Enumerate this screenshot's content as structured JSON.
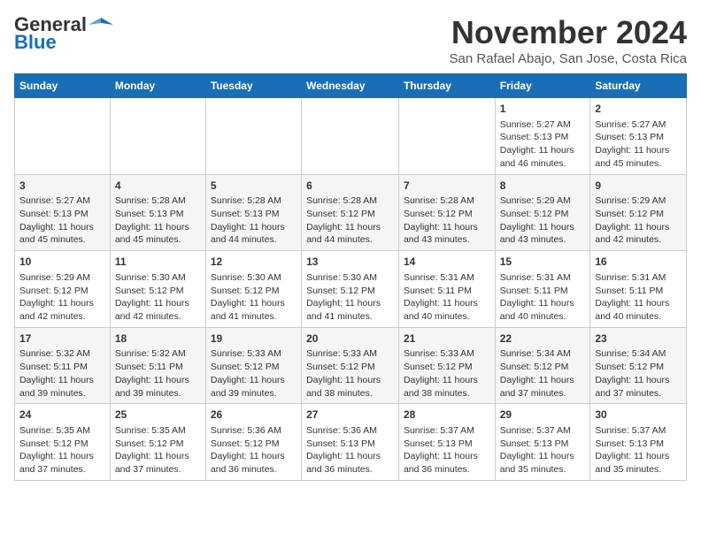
{
  "logo": {
    "line1": "General",
    "line2": "Blue"
  },
  "title": "November 2024",
  "subtitle": "San Rafael Abajo, San Jose, Costa Rica",
  "days_of_week": [
    "Sunday",
    "Monday",
    "Tuesday",
    "Wednesday",
    "Thursday",
    "Friday",
    "Saturday"
  ],
  "weeks": [
    [
      {
        "day": "",
        "info": ""
      },
      {
        "day": "",
        "info": ""
      },
      {
        "day": "",
        "info": ""
      },
      {
        "day": "",
        "info": ""
      },
      {
        "day": "",
        "info": ""
      },
      {
        "day": "1",
        "info": "Sunrise: 5:27 AM\nSunset: 5:13 PM\nDaylight: 11 hours and 46 minutes."
      },
      {
        "day": "2",
        "info": "Sunrise: 5:27 AM\nSunset: 5:13 PM\nDaylight: 11 hours and 45 minutes."
      }
    ],
    [
      {
        "day": "3",
        "info": "Sunrise: 5:27 AM\nSunset: 5:13 PM\nDaylight: 11 hours and 45 minutes."
      },
      {
        "day": "4",
        "info": "Sunrise: 5:28 AM\nSunset: 5:13 PM\nDaylight: 11 hours and 45 minutes."
      },
      {
        "day": "5",
        "info": "Sunrise: 5:28 AM\nSunset: 5:13 PM\nDaylight: 11 hours and 44 minutes."
      },
      {
        "day": "6",
        "info": "Sunrise: 5:28 AM\nSunset: 5:12 PM\nDaylight: 11 hours and 44 minutes."
      },
      {
        "day": "7",
        "info": "Sunrise: 5:28 AM\nSunset: 5:12 PM\nDaylight: 11 hours and 43 minutes."
      },
      {
        "day": "8",
        "info": "Sunrise: 5:29 AM\nSunset: 5:12 PM\nDaylight: 11 hours and 43 minutes."
      },
      {
        "day": "9",
        "info": "Sunrise: 5:29 AM\nSunset: 5:12 PM\nDaylight: 11 hours and 42 minutes."
      }
    ],
    [
      {
        "day": "10",
        "info": "Sunrise: 5:29 AM\nSunset: 5:12 PM\nDaylight: 11 hours and 42 minutes."
      },
      {
        "day": "11",
        "info": "Sunrise: 5:30 AM\nSunset: 5:12 PM\nDaylight: 11 hours and 42 minutes."
      },
      {
        "day": "12",
        "info": "Sunrise: 5:30 AM\nSunset: 5:12 PM\nDaylight: 11 hours and 41 minutes."
      },
      {
        "day": "13",
        "info": "Sunrise: 5:30 AM\nSunset: 5:12 PM\nDaylight: 11 hours and 41 minutes."
      },
      {
        "day": "14",
        "info": "Sunrise: 5:31 AM\nSunset: 5:11 PM\nDaylight: 11 hours and 40 minutes."
      },
      {
        "day": "15",
        "info": "Sunrise: 5:31 AM\nSunset: 5:11 PM\nDaylight: 11 hours and 40 minutes."
      },
      {
        "day": "16",
        "info": "Sunrise: 5:31 AM\nSunset: 5:11 PM\nDaylight: 11 hours and 40 minutes."
      }
    ],
    [
      {
        "day": "17",
        "info": "Sunrise: 5:32 AM\nSunset: 5:11 PM\nDaylight: 11 hours and 39 minutes."
      },
      {
        "day": "18",
        "info": "Sunrise: 5:32 AM\nSunset: 5:11 PM\nDaylight: 11 hours and 39 minutes."
      },
      {
        "day": "19",
        "info": "Sunrise: 5:33 AM\nSunset: 5:12 PM\nDaylight: 11 hours and 39 minutes."
      },
      {
        "day": "20",
        "info": "Sunrise: 5:33 AM\nSunset: 5:12 PM\nDaylight: 11 hours and 38 minutes."
      },
      {
        "day": "21",
        "info": "Sunrise: 5:33 AM\nSunset: 5:12 PM\nDaylight: 11 hours and 38 minutes."
      },
      {
        "day": "22",
        "info": "Sunrise: 5:34 AM\nSunset: 5:12 PM\nDaylight: 11 hours and 37 minutes."
      },
      {
        "day": "23",
        "info": "Sunrise: 5:34 AM\nSunset: 5:12 PM\nDaylight: 11 hours and 37 minutes."
      }
    ],
    [
      {
        "day": "24",
        "info": "Sunrise: 5:35 AM\nSunset: 5:12 PM\nDaylight: 11 hours and 37 minutes."
      },
      {
        "day": "25",
        "info": "Sunrise: 5:35 AM\nSunset: 5:12 PM\nDaylight: 11 hours and 37 minutes."
      },
      {
        "day": "26",
        "info": "Sunrise: 5:36 AM\nSunset: 5:12 PM\nDaylight: 11 hours and 36 minutes."
      },
      {
        "day": "27",
        "info": "Sunrise: 5:36 AM\nSunset: 5:13 PM\nDaylight: 11 hours and 36 minutes."
      },
      {
        "day": "28",
        "info": "Sunrise: 5:37 AM\nSunset: 5:13 PM\nDaylight: 11 hours and 36 minutes."
      },
      {
        "day": "29",
        "info": "Sunrise: 5:37 AM\nSunset: 5:13 PM\nDaylight: 11 hours and 35 minutes."
      },
      {
        "day": "30",
        "info": "Sunrise: 5:37 AM\nSunset: 5:13 PM\nDaylight: 11 hours and 35 minutes."
      }
    ]
  ]
}
